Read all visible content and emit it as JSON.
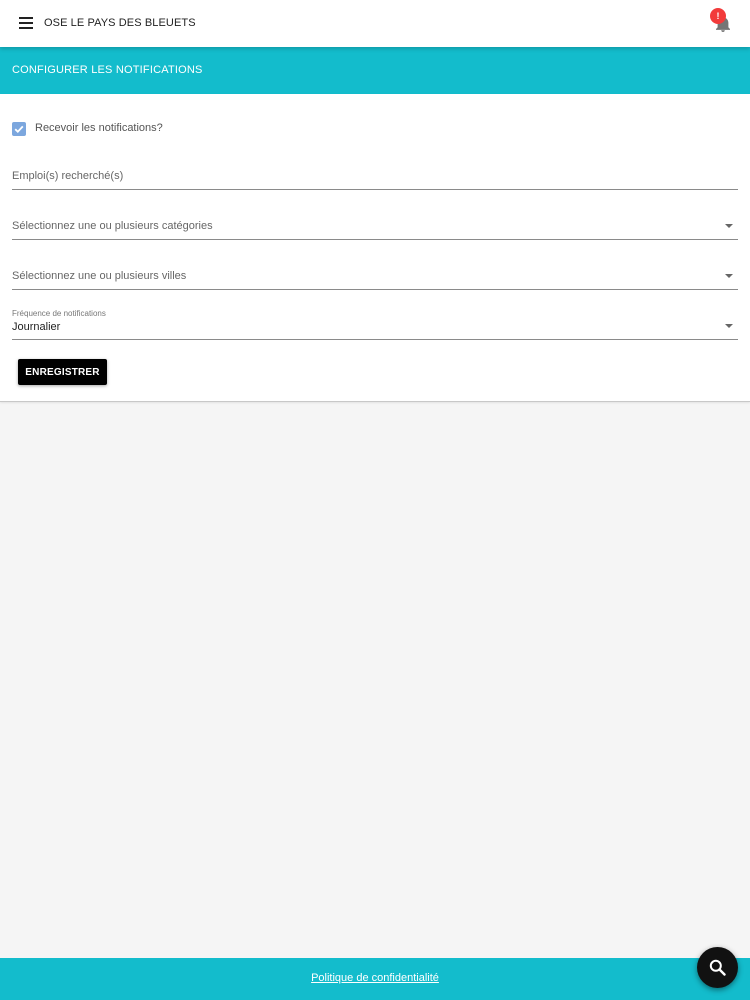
{
  "app": {
    "title": "OSE LE PAYS DES BLEUETS",
    "notification_badge": "!",
    "menu_icon": "menu-icon",
    "notification_icon": "bell-icon"
  },
  "section": {
    "title": "CONFIGURER LES NOTIFICATIONS"
  },
  "form": {
    "receive_notifications": {
      "label": "Recevoir les notifications?",
      "checked": true
    },
    "job_field": {
      "placeholder": "Emploi(s) recherché(s)",
      "value": ""
    },
    "categories_select": {
      "placeholder": "Sélectionnez une ou plusieurs catégories"
    },
    "cities_select": {
      "placeholder": "Sélectionnez une ou plusieurs villes"
    },
    "frequency_select": {
      "label": "Fréquence de notifications",
      "value": "Journalier"
    },
    "save_label": "ENREGISTRER"
  },
  "footer": {
    "privacy_link": "Politique de confidentialité"
  },
  "fab": {
    "icon": "search-icon"
  },
  "colors": {
    "accent": "#13bccc",
    "checkbox": "#7ca7de",
    "badge": "#f23b3b",
    "button": "#000000"
  }
}
